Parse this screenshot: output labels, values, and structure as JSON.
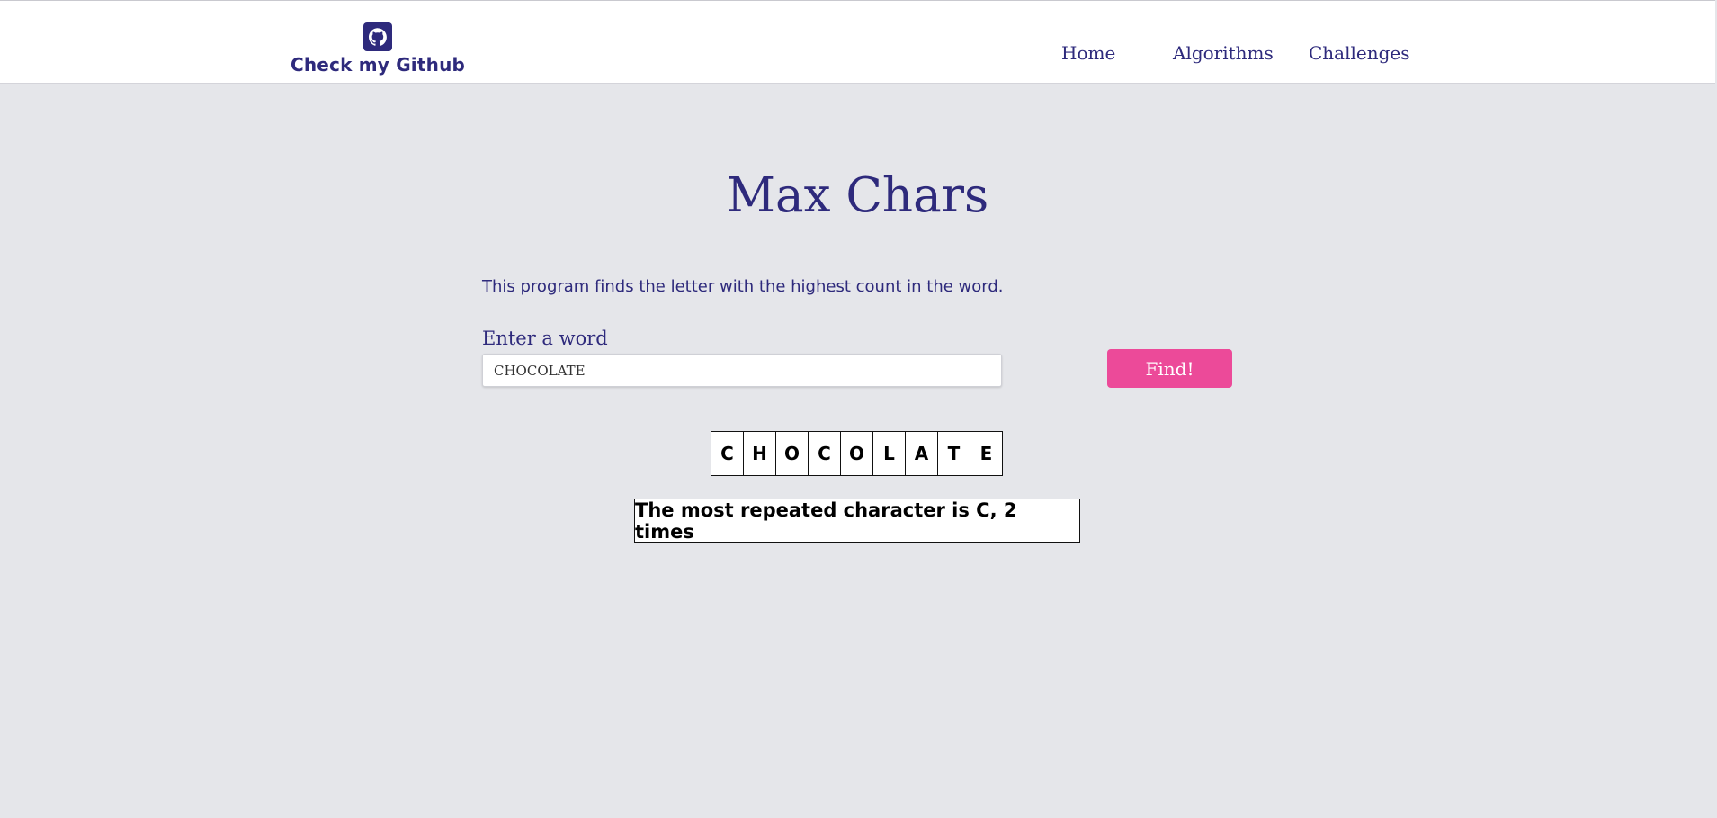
{
  "navbar": {
    "brand_label": "Check my Github",
    "brand_icon": "github-icon",
    "links": [
      {
        "label": "Home"
      },
      {
        "label": "Algorithms"
      },
      {
        "label": "Challenges"
      }
    ]
  },
  "main": {
    "title": "Max Chars",
    "description": "This program finds the letter with the highest count in the word.",
    "input_label": "Enter a word",
    "input_value": "CHOCOLATE",
    "button_label": "Find!",
    "letters": [
      "C",
      "H",
      "O",
      "C",
      "O",
      "L",
      "A",
      "T",
      "E"
    ],
    "result": "The most repeated character is C, 2 times"
  },
  "colors": {
    "primary": "#2e2a7c",
    "accent": "#ec4a99",
    "background": "#e5e6ea",
    "navbar": "#ffffff"
  }
}
